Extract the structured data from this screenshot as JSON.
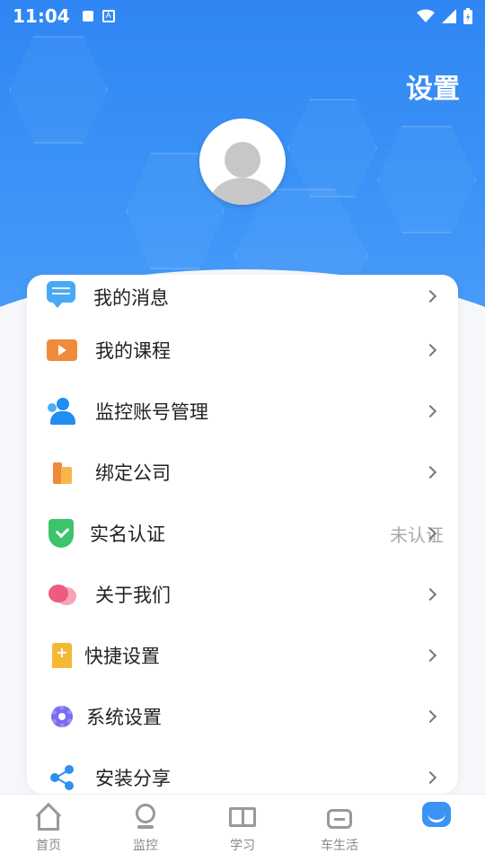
{
  "status_bar": {
    "time": "11:04"
  },
  "header": {
    "title": "设置"
  },
  "menu": {
    "items": [
      {
        "label": "我的消息",
        "icon": "message-icon",
        "value": ""
      },
      {
        "label": "我的课程",
        "icon": "course-video-icon",
        "value": ""
      },
      {
        "label": "监控账号管理",
        "icon": "account-users-icon",
        "value": ""
      },
      {
        "label": "绑定公司",
        "icon": "company-building-icon",
        "value": ""
      },
      {
        "label": "实名认证",
        "icon": "shield-check-icon",
        "value": "未认证"
      },
      {
        "label": "关于我们",
        "icon": "about-bubble-icon",
        "value": ""
      },
      {
        "label": "快捷设置",
        "icon": "bookmark-plus-icon",
        "value": ""
      },
      {
        "label": "系统设置",
        "icon": "gear-icon",
        "value": ""
      },
      {
        "label": "安装分享",
        "icon": "share-icon",
        "value": ""
      }
    ]
  },
  "bottom_nav": {
    "items": [
      {
        "label": "首页",
        "icon": "home-icon"
      },
      {
        "label": "监控",
        "icon": "camera-icon"
      },
      {
        "label": "学习",
        "icon": "book-icon"
      },
      {
        "label": "车生活",
        "icon": "car-life-icon"
      },
      {
        "label": "",
        "icon": "me-face-icon",
        "active": true
      }
    ]
  },
  "colors": {
    "header_blue": "#2f86f3",
    "accent": "#3a93f5",
    "text_primary": "#222222",
    "text_secondary": "#aaaaaa"
  }
}
